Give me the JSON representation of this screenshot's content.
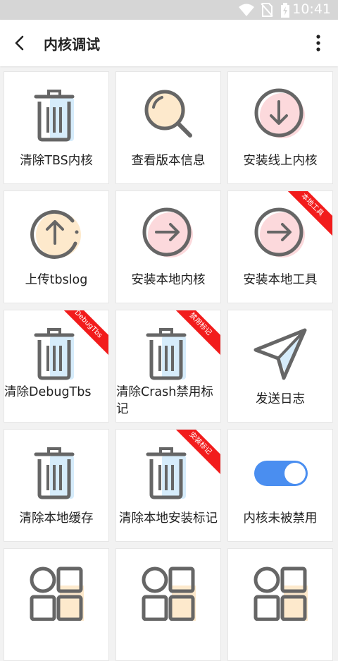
{
  "status_bar": {
    "time": "10:41"
  },
  "app_bar": {
    "title": "内核调试"
  },
  "tiles": [
    {
      "label": "清除TBS内核",
      "icon": "trash-icon",
      "accent": "#d6ecfb"
    },
    {
      "label": "查看版本信息",
      "icon": "magnifier-icon",
      "accent": "#fde9cc"
    },
    {
      "label": "安装线上内核",
      "icon": "download-circle-icon",
      "accent": "#fcd9dc"
    },
    {
      "label": "上传tbslog",
      "icon": "upload-circle-icon",
      "accent": "#fde9cc"
    },
    {
      "label": "安装本地内核",
      "icon": "arrow-right-circle-icon",
      "accent": "#fcd9dc"
    },
    {
      "label": "安装本地工具",
      "icon": "arrow-right-circle-icon",
      "accent": "#fcd9dc",
      "badge": "本地工具"
    },
    {
      "label": "清除DebugTbs",
      "icon": "trash-icon",
      "accent": "#d6ecfb",
      "badge": "DebugTbs"
    },
    {
      "label": "清除Crash禁用标记",
      "icon": "trash-icon",
      "accent": "#d6ecfb",
      "badge": "禁用标记"
    },
    {
      "label": "发送日志",
      "icon": "paper-plane-icon",
      "accent": "#d6ecfb"
    },
    {
      "label": "清除本地缓存",
      "icon": "trash-icon",
      "accent": "#d6ecfb"
    },
    {
      "label": "清除本地安装标记",
      "icon": "trash-icon",
      "accent": "#d6ecfb",
      "badge": "安装标记"
    },
    {
      "label": "内核未被禁用",
      "icon": "toggle-switch-icon",
      "accent": "#4a8ef0",
      "toggle_on": true
    },
    {
      "label": "",
      "icon": "grid-apps-icon",
      "accent": "#fde9cc"
    },
    {
      "label": "",
      "icon": "grid-apps-icon",
      "accent": "#fde9cc"
    },
    {
      "label": "",
      "icon": "grid-apps-icon",
      "accent": "#fde9cc"
    }
  ],
  "colors": {
    "stroke": "#666666",
    "badge": "#f21c1c",
    "toggle_on": "#4a8ef0"
  }
}
